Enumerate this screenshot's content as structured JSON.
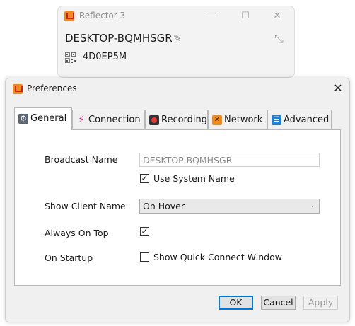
{
  "background_window": {
    "title": "Reflector 3",
    "device_name": "DESKTOP-BQMHSGR",
    "connect_code": "4D0EP5M",
    "controls": {
      "minimize": "—",
      "maximize": "☐",
      "close": "✕"
    }
  },
  "dialog": {
    "title": "Preferences",
    "close": "✕",
    "tabs": [
      {
        "label": "General",
        "icon": "gear-icon",
        "color": "#5a6672"
      },
      {
        "label": "Connection",
        "icon": "connection-icon",
        "color": "#e0257a"
      },
      {
        "label": "Recording",
        "icon": "record-icon",
        "color": "#c62828"
      },
      {
        "label": "Network",
        "icon": "network-icon",
        "color": "#f08a1c"
      },
      {
        "label": "Advanced",
        "icon": "sliders-icon",
        "color": "#1e7fd6"
      }
    ],
    "general": {
      "broadcast_name_label": "Broadcast Name",
      "broadcast_name_value": "DESKTOP-BQMHSGR",
      "use_system_name_label": "Use System Name",
      "use_system_name_checked": true,
      "show_client_name_label": "Show Client Name",
      "show_client_name_value": "On Hover",
      "always_on_top_label": "Always On Top",
      "always_on_top_checked": true,
      "on_startup_label": "On Startup",
      "show_quick_connect_label": "Show Quick Connect Window",
      "show_quick_connect_checked": false
    },
    "buttons": {
      "ok": "OK",
      "cancel": "Cancel",
      "apply": "Apply"
    }
  }
}
